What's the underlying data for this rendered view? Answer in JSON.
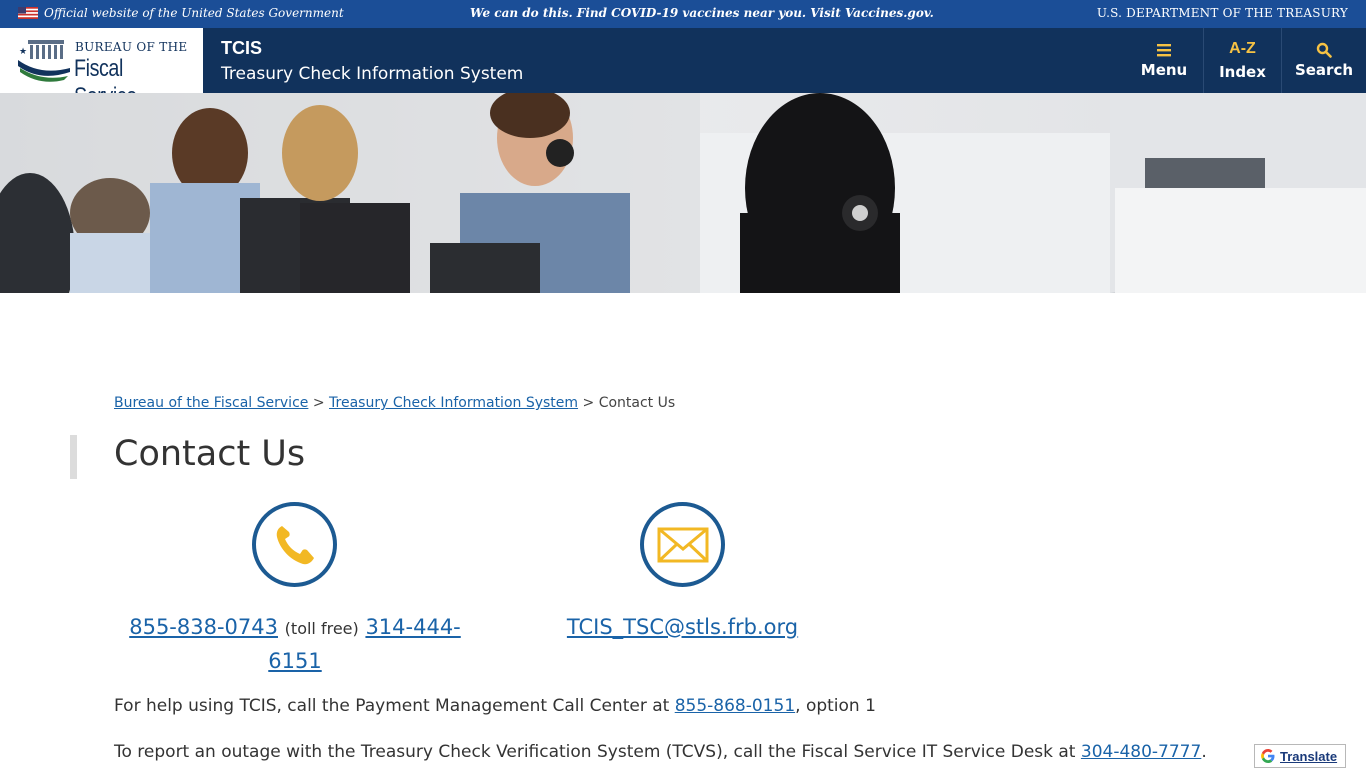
{
  "gov_banner": {
    "official": "Official website of the United States Government",
    "covid": "We can do this. Find COVID-19 vaccines near you. Visit Vaccines.gov.",
    "department": "U.S. DEPARTMENT OF THE TREASURY"
  },
  "header": {
    "logo_line1": "BUREAU OF THE",
    "logo_line2": "Fiscal Service",
    "site_title": "TCIS",
    "site_subtitle": "Treasury Check Information System",
    "nav": {
      "menu": {
        "icon": "hamburger-icon",
        "label": "Menu"
      },
      "index": {
        "icon_text": "A-Z",
        "label": "Index"
      },
      "search": {
        "icon": "search-icon",
        "label": "Search"
      }
    }
  },
  "breadcrumb": {
    "item1": "Bureau of the Fiscal Service",
    "separator": ">",
    "item2": "Treasury Check Information System",
    "current": "Contact Us"
  },
  "page_title": "Contact Us",
  "contact": {
    "phone_toll_free": "855-838-0743",
    "toll_free_label": "(toll free)",
    "phone_local": "314-444-6151",
    "email": "TCIS_TSC@stls.frb.org"
  },
  "paragraphs": {
    "p1_prefix": "For help using TCIS, call the Payment Management Call Center at",
    "p1_phone": "855-868-0151",
    "p1_suffix": ", option 1",
    "p2_prefix": "To report an outage with the Treasury Check Verification System (TCVS), call the Fiscal Service IT Service Desk at",
    "p2_phone": "304-480-7777",
    "p2_suffix": "."
  },
  "translate": {
    "label": "Translate"
  },
  "colors": {
    "banner": "#1b4e97",
    "header": "#11325c",
    "accent": "#f6c244",
    "link": "#1a63a8",
    "circle_border": "#1c5a92"
  }
}
